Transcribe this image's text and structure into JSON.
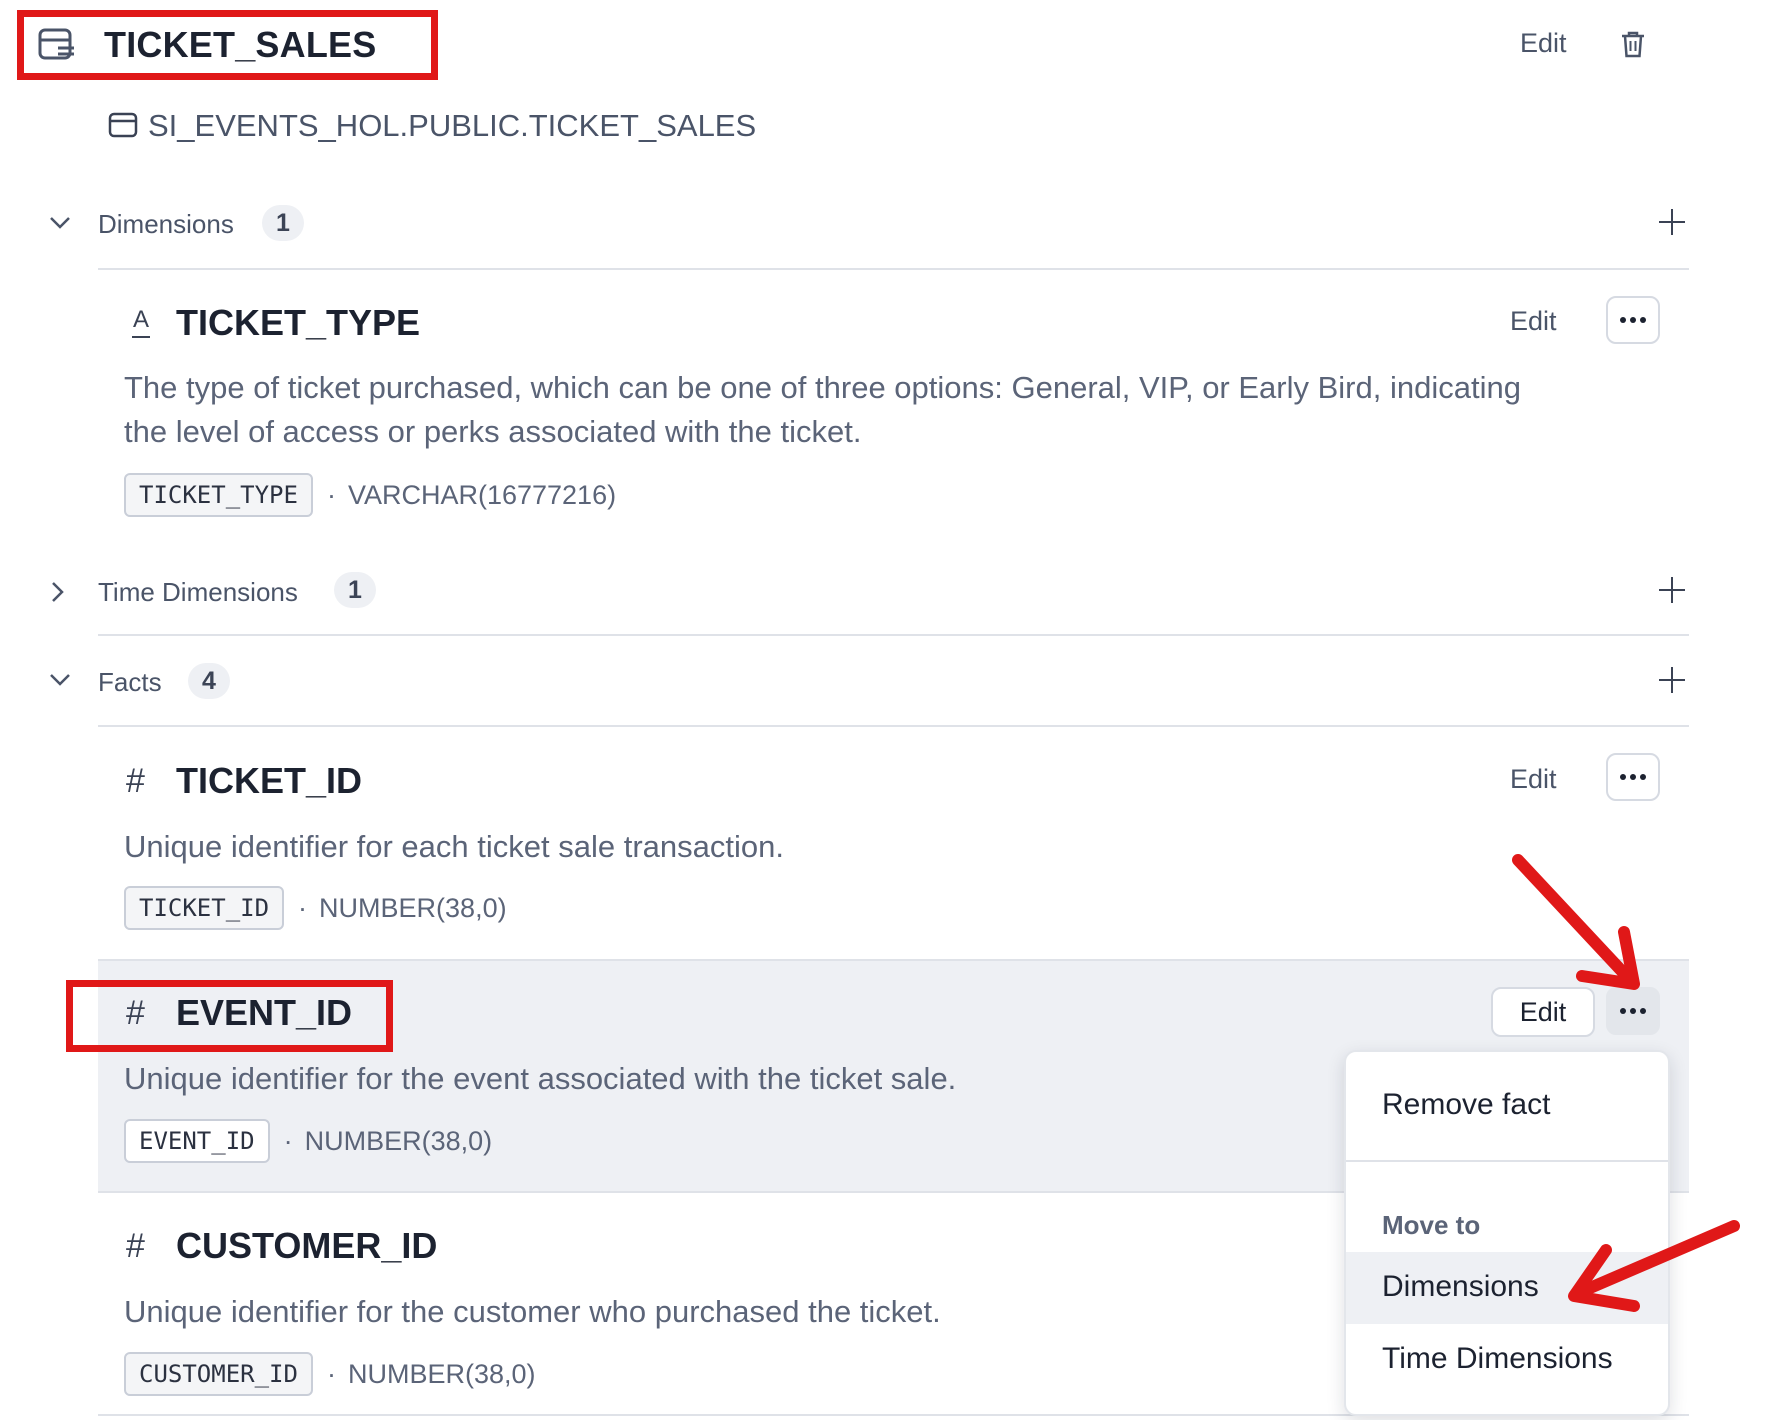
{
  "table": {
    "name": "TICKET_SALES",
    "source": "SI_EVENTS_HOL.PUBLIC.TICKET_SALES",
    "edit_label": "Edit"
  },
  "sections": {
    "dimensions": {
      "label": "Dimensions",
      "count": "1"
    },
    "time_dimensions": {
      "label": "Time Dimensions",
      "count": "1"
    },
    "facts": {
      "label": "Facts",
      "count": "4"
    }
  },
  "dimension_items": [
    {
      "name": "TICKET_TYPE",
      "description_line1": "The type of ticket purchased, which can be one of three options: General, VIP, or Early Bird, indicating",
      "description_line2": "the level of access or perks associated with the ticket.",
      "column": "TICKET_TYPE",
      "datatype": "VARCHAR(16777216)",
      "edit_label": "Edit"
    }
  ],
  "fact_items": [
    {
      "name": "TICKET_ID",
      "description": "Unique identifier for each ticket sale transaction.",
      "column": "TICKET_ID",
      "datatype": "NUMBER(38,0)",
      "edit_label": "Edit"
    },
    {
      "name": "EVENT_ID",
      "description": "Unique identifier for the event associated with the ticket sale.",
      "column": "EVENT_ID",
      "datatype": "NUMBER(38,0)",
      "edit_label": "Edit"
    },
    {
      "name": "CUSTOMER_ID",
      "description": "Unique identifier for the customer who purchased the ticket.",
      "column": "CUSTOMER_ID",
      "datatype": "NUMBER(38,0)"
    }
  ],
  "separator": "·",
  "context_menu": {
    "remove": "Remove fact",
    "move_to_label": "Move to",
    "move_dimensions": "Dimensions",
    "move_time_dimensions": "Time Dimensions"
  },
  "icons": {
    "table": "table-icon",
    "database": "database-table-icon",
    "trash": "trash-icon",
    "text_type": "text-type-icon",
    "number_type": "hash-icon",
    "chevron_down": "chevron-down-icon",
    "chevron_right": "chevron-right-icon",
    "plus": "plus-icon",
    "more": "more-dots-icon"
  },
  "colors": {
    "highlight_red": "#e01818",
    "hover_row": "#eef0f4",
    "text_primary": "#1c2230",
    "text_muted": "#5b6478"
  }
}
